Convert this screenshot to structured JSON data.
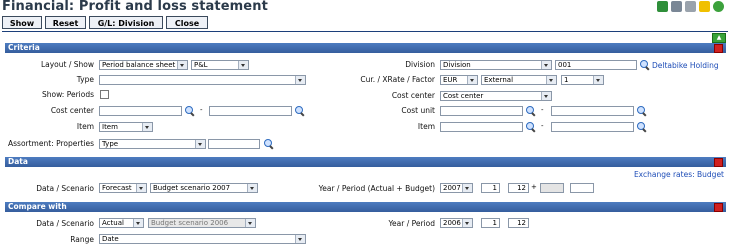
{
  "window": {
    "title": "Financial: Profit and loss statement"
  },
  "toolbar": {
    "show": "Show",
    "reset": "Reset",
    "gl_division": "G/L: Division",
    "close": "Close"
  },
  "criteria": {
    "header": "Criteria",
    "layout_label": "Layout / Show",
    "layout_value": "Period balance sheet",
    "show_value": "P&L",
    "type_label": "Type",
    "type_value": "",
    "show_periods_label": "Show: Periods",
    "cost_center_label": "Cost center",
    "item_label": "Item",
    "item_value": "Item",
    "assort_label": "Assortment: Properties",
    "assort_value": "Type",
    "division_label": "Division",
    "division_value": "Division",
    "division_code": "001",
    "division_link": "Deltabike Holding",
    "cur_label": "Cur. / XRate / Factor",
    "cur_value": "EUR",
    "xrate_value": "External",
    "factor_value": "1",
    "cost_center_r_label": "Cost center",
    "cost_center_r_value": "Cost center",
    "cost_unit_label": "Cost unit",
    "item_r_label": "Item",
    "dash": "-"
  },
  "data": {
    "header": "Data",
    "exchange_link": "Exchange rates: Budget",
    "scenario_label": "Data / Scenario",
    "data_value": "Forecast",
    "scenario_value": "Budget scenario 2007",
    "yp_label": "Year / Period (Actual + Budget)",
    "year": "2007",
    "period_from": "1",
    "period_to": "12",
    "plus": "+"
  },
  "compare": {
    "header": "Compare with",
    "scenario_label": "Data / Scenario",
    "data_value": "Actual",
    "scenario_value": "Budget scenario 2006",
    "range_label": "Range",
    "range_value": "Date",
    "yp_label": "Year / Period",
    "year": "2006",
    "period_from": "1",
    "period_to": "12"
  },
  "colors": {
    "section": "#3f6bb0",
    "title": "#2b3a4a",
    "link": "#1e4db7"
  }
}
